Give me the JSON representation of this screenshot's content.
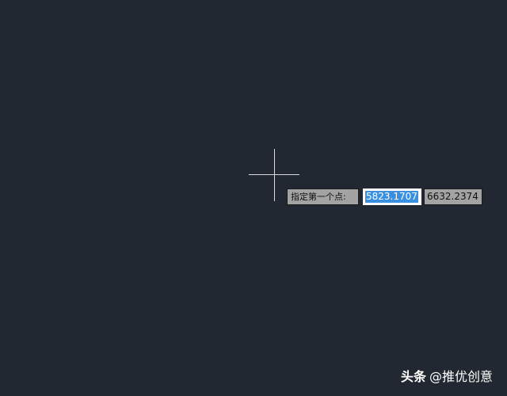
{
  "prompt": {
    "label": "指定第一个点:"
  },
  "coordinates": {
    "x_value": "5823.1707",
    "y_value": "6632.2374"
  },
  "watermark": {
    "brand": "头条",
    "handle": "@推优创意"
  },
  "colors": {
    "background": "#222831",
    "crosshair": "#d8dadd",
    "selection": "#3a90e0",
    "tooltip_bg": "#a3a3a3"
  },
  "icons": {
    "cursor": "crosshair-icon"
  }
}
